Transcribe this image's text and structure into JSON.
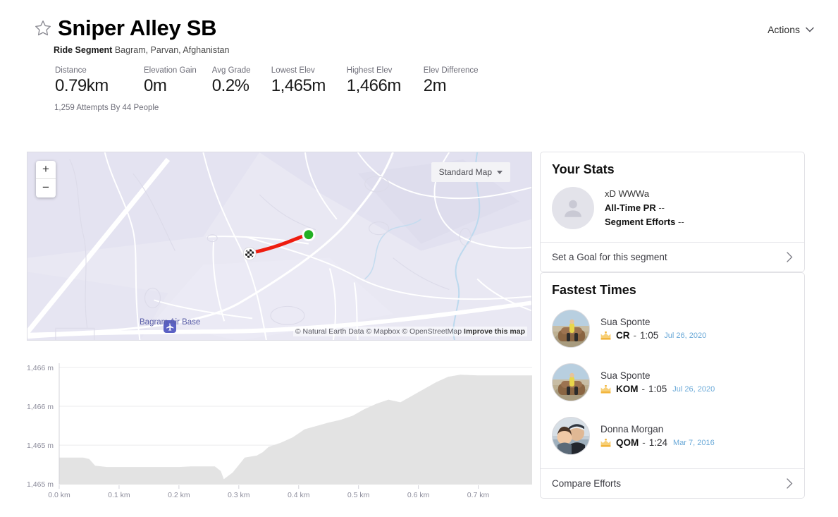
{
  "header": {
    "star_icon": "star-outline-icon",
    "title": "Sniper Alley SB",
    "subtitle_type": "Ride Segment",
    "subtitle_location": "Bagram, Parvan, Afghanistan",
    "actions_label": "Actions",
    "actions_icon": "chevron-down-icon"
  },
  "stats": [
    {
      "label": "Distance",
      "value": "0.79km"
    },
    {
      "label": "Elevation Gain",
      "value": "0m"
    },
    {
      "label": "Avg Grade",
      "value": "0.2%"
    },
    {
      "label": "Lowest Elev",
      "value": "1,465m"
    },
    {
      "label": "Highest Elev",
      "value": "1,466m"
    },
    {
      "label": "Elev Difference",
      "value": "2m"
    }
  ],
  "attempts_text": "1,259 Attempts By 44 People",
  "map": {
    "zoom_in_label": "+",
    "zoom_out_label": "−",
    "style_label": "Standard Map",
    "style_icon": "caret-down-icon",
    "poi_label": "Bagram Air Base",
    "poi_icon": "airport-icon",
    "attribution": "© Natural Earth Data © Mapbox © OpenStreetMap",
    "attribution_link": "Improve this map",
    "start_marker": "green-dot-start-marker",
    "end_marker": "checkered-flag-finish-marker",
    "route_color": "#ee1c0f",
    "base_color": "#e9e8f3"
  },
  "chart_data": {
    "type": "area",
    "title": "",
    "xlabel": "",
    "ylabel": "",
    "x_ticks": [
      "0.0 km",
      "0.1 km",
      "0.2 km",
      "0.3 km",
      "0.4 km",
      "0.5 km",
      "0.6 km",
      "0.7 km"
    ],
    "y_ticks": [
      "1,466 m",
      "1,466 m",
      "1,465 m",
      "1,465 m"
    ],
    "xlim": [
      0.0,
      0.79
    ],
    "ylim": [
      1464.6,
      1466.4
    ],
    "grid": true,
    "legend": "none",
    "fill_color": "#e3e3e3",
    "x": [
      0.0,
      0.02,
      0.04,
      0.05,
      0.06,
      0.08,
      0.1,
      0.14,
      0.18,
      0.2,
      0.22,
      0.25,
      0.26,
      0.27,
      0.275,
      0.29,
      0.31,
      0.33,
      0.34,
      0.35,
      0.37,
      0.39,
      0.41,
      0.43,
      0.45,
      0.47,
      0.49,
      0.51,
      0.53,
      0.55,
      0.57,
      0.59,
      0.61,
      0.63,
      0.65,
      0.67,
      0.7,
      0.73,
      0.76,
      0.79
    ],
    "y": [
      1465.0,
      1465.0,
      1465.0,
      1464.98,
      1464.88,
      1464.86,
      1464.86,
      1464.86,
      1464.86,
      1464.86,
      1464.87,
      1464.87,
      1464.87,
      1464.8,
      1464.68,
      1464.78,
      1465.0,
      1465.03,
      1465.08,
      1465.16,
      1465.22,
      1465.3,
      1465.42,
      1465.47,
      1465.52,
      1465.56,
      1465.62,
      1465.72,
      1465.8,
      1465.86,
      1465.82,
      1465.92,
      1466.02,
      1466.12,
      1466.2,
      1466.23,
      1466.22,
      1466.22,
      1466.22,
      1466.22
    ]
  },
  "your_stats": {
    "title": "Your Stats",
    "avatar": "default-avatar-icon",
    "athlete_name": "xD WWWa",
    "pr_label": "All-Time PR",
    "pr_value": "--",
    "efforts_label": "Segment Efforts",
    "efforts_value": "--",
    "footer_label": "Set a Goal for this segment",
    "footer_icon": "chevron-right-icon"
  },
  "fastest_times": {
    "title": "Fastest Times",
    "rows": [
      {
        "name": "Sua Sponte",
        "badge": "CR",
        "separator": "-",
        "time": "1:05",
        "date": "Jul 26, 2020",
        "icon": "crown-icon"
      },
      {
        "name": "Sua Sponte",
        "badge": "KOM",
        "separator": "-",
        "time": "1:05",
        "date": "Jul 26, 2020",
        "icon": "crown-icon"
      },
      {
        "name": "Donna Morgan",
        "badge": "QOM",
        "separator": "-",
        "time": "1:24",
        "date": "Mar 7, 2016",
        "icon": "crown-icon"
      }
    ],
    "footer_label": "Compare Efforts",
    "footer_icon": "chevron-right-icon"
  },
  "colors": {
    "accent_red": "#ee1c0f",
    "crown_gold": "#f2b53c",
    "link_blue": "#6aa9d8"
  }
}
